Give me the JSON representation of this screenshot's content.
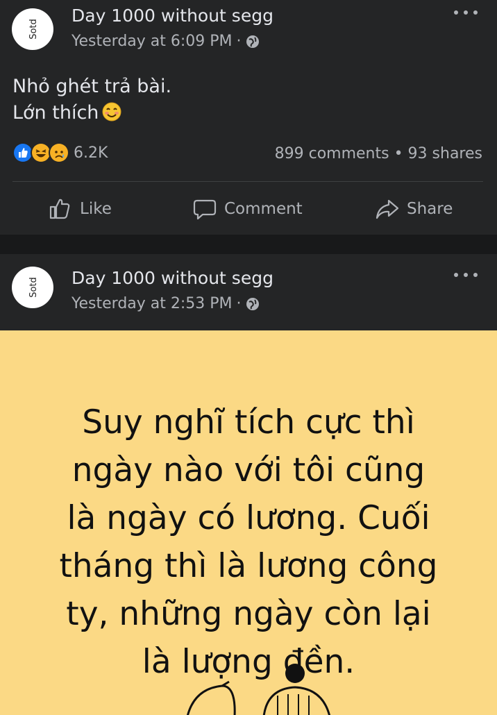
{
  "post1": {
    "page_name": "Day 1000 without segg",
    "time": "Yesterday at 6:09 PM",
    "separator": "·",
    "privacy_icon": "globe-icon",
    "text_line1": "Nhỏ ghét trả bài.",
    "text_line2": "Lớn thích",
    "text_emoji": "smiling-face-emoji",
    "reactions": [
      "like",
      "haha",
      "sad"
    ],
    "reaction_count": "6.2K",
    "stats": "899 comments • 93 shares",
    "actions": {
      "like": "Like",
      "comment": "Comment",
      "share": "Share"
    }
  },
  "post2": {
    "page_name": "Day 1000 without segg",
    "time": "Yesterday at 2:53 PM",
    "separator": "·",
    "privacy_icon": "globe-icon",
    "quote_lines": [
      "Suy nghĩ tích cực thì",
      "ngày nào với tôi cũng",
      "là ngày có lương. Cuối",
      "tháng thì là lương công",
      "ty, những ngày còn lại",
      "là lượng đền."
    ],
    "card_color": "#fbd985"
  },
  "colors": {
    "card_bg": "#242526",
    "text_primary": "#e4e6eb",
    "text_secondary": "#b0b3b8",
    "like_blue": "#1877f2",
    "haha_yellow": "#f7b125"
  }
}
